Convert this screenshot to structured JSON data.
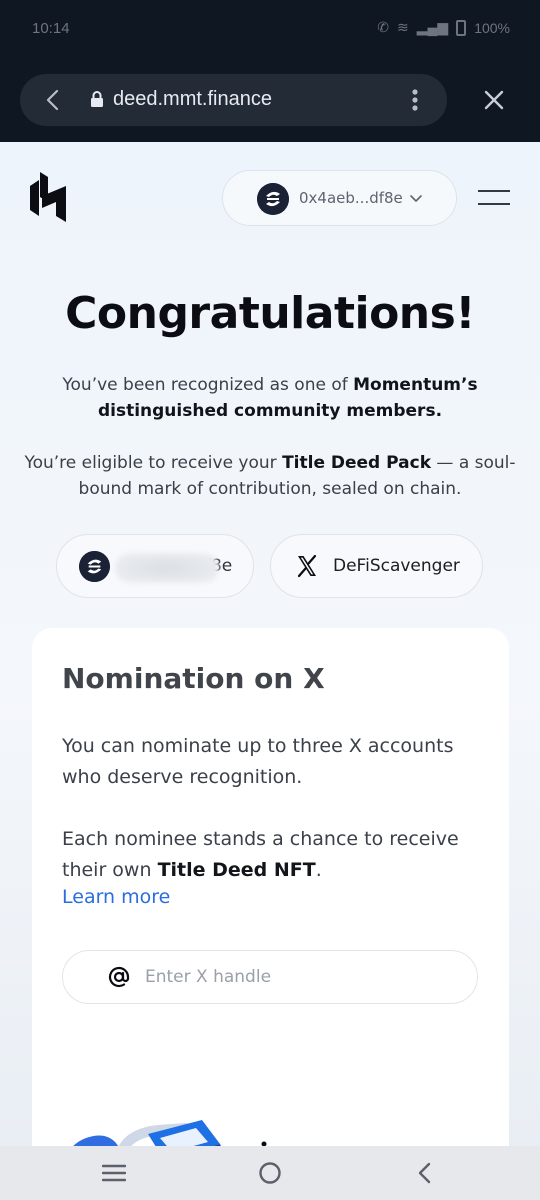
{
  "status_bar": {
    "time": "10:14",
    "battery": "100%"
  },
  "browser": {
    "url": "deed.mmt.finance"
  },
  "header": {
    "wallet_address": "0x4aeb...df8e"
  },
  "hero": {
    "title": "Congratulations!",
    "recognized_prefix": "You’ve been recognized as one of ",
    "recognized_bold": "Momentum’s distinguished community members.",
    "eligible_prefix": "You’re eligible to receive your ",
    "eligible_bold": "Title Deed Pack",
    "eligible_suffix": " — a soul-bound mark of contribution, sealed on chain."
  },
  "chips": {
    "wallet_suffix": "f8e",
    "x_handle": "DeFiScavenger"
  },
  "nomination": {
    "title": "Nomination on X",
    "text1": "You can nominate up to three X accounts who deserve recognition.",
    "text2_prefix": "Each nominee stands a chance to receive their own ",
    "text2_bold": "Title Deed NFT",
    "text2_suffix": ".",
    "learn_more": "Learn more",
    "input_placeholder": "Enter X handle"
  },
  "colors": {
    "link": "#2a6ddf",
    "dark": "#0f1722",
    "avatar": "#1c2236"
  },
  "icons": [
    "back-arrow-icon",
    "lock-icon",
    "more-vertical-icon",
    "close-icon",
    "momentum-logo-icon",
    "chevron-down-icon",
    "menu-icon",
    "x-logo-icon",
    "at-sign-icon",
    "recent-apps-icon",
    "home-icon",
    "nav-back-icon"
  ]
}
